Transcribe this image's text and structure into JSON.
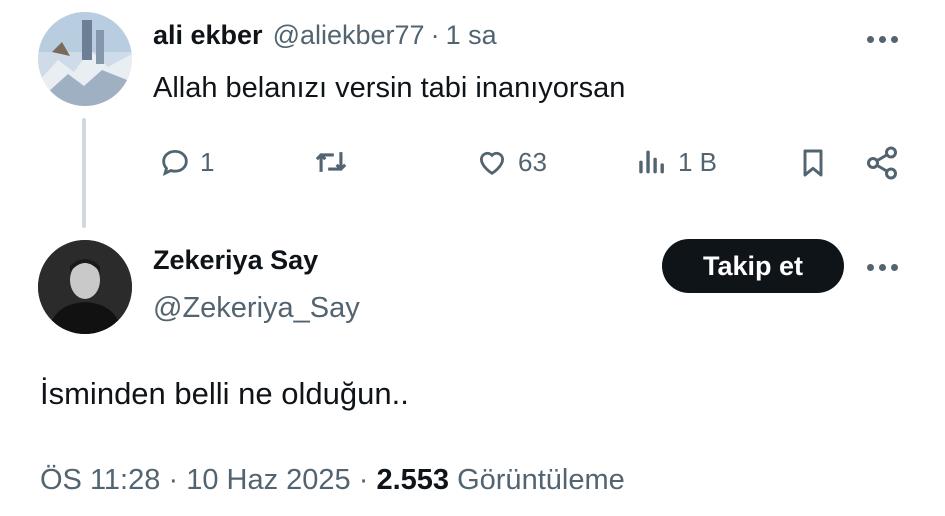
{
  "reply_tweet": {
    "author_name": "ali ekber",
    "author_handle": "@aliekber77",
    "separator": "·",
    "time_ago": "1 sa",
    "text": "Allah belanızı versin tabi inanıyorsan",
    "actions": {
      "replies": "1",
      "retweets": "",
      "likes": "63",
      "views": "1 B"
    }
  },
  "main_tweet": {
    "author_name": "Zekeriya Say",
    "author_handle": "@Zekeriya_Say",
    "follow_label": "Takip et",
    "text": "İsminden belli ne olduğun..",
    "time": "ÖS 11:28",
    "sep1": "·",
    "date": "10 Haz 2025",
    "sep2": "·",
    "views_count": "2.553",
    "views_label": "Görüntüleme"
  },
  "icons": [
    "reply-icon",
    "retweet-icon",
    "like-icon",
    "views-icon",
    "bookmark-icon",
    "share-icon",
    "more-icon"
  ],
  "colors": {
    "text": "#0f1419",
    "muted": "#536471",
    "line": "#cfd9de",
    "button": "#0f1419"
  }
}
